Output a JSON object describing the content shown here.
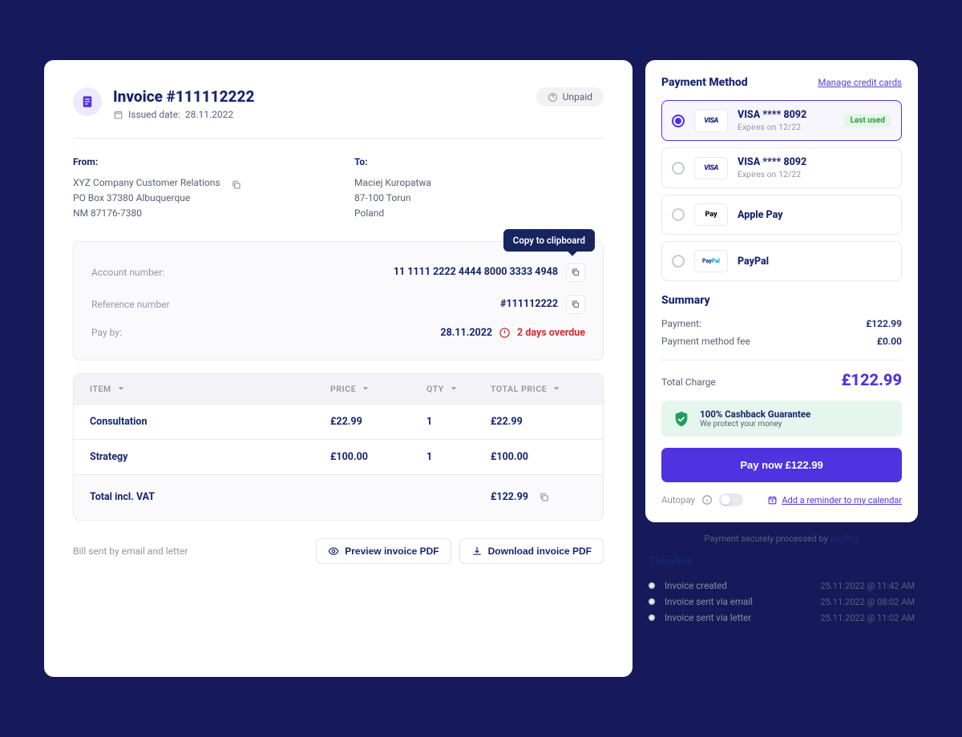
{
  "invoice": {
    "title": "Invoice #111112222",
    "issued_label": "Issued date:",
    "issued_date": "28.11.2022",
    "status": "Unpaid"
  },
  "from": {
    "label": "From:",
    "line1": "XYZ Company Customer Relations",
    "line2": "PO Box 37380 Albuquerque",
    "line3": "NM 87176-7380"
  },
  "to": {
    "label": "To:",
    "line1": "Maciej Kuropatwa",
    "line2": "87-100 Torun",
    "line3": "Poland"
  },
  "payinfo": {
    "account_label": "Account number:",
    "account_value": "11 1111 2222 4444 8000 3333 4948",
    "reference_label": "Reference number",
    "reference_value": "#111112222",
    "payby_label": "Pay by:",
    "payby_date": "28.11.2022",
    "overdue": "2 days overdue",
    "tooltip": "Copy to clipboard"
  },
  "items": {
    "headers": {
      "item": "ITEM",
      "price": "PRICE",
      "qty": "QTY",
      "total": "TOTAL PRICE"
    },
    "rows": [
      {
        "item": "Consultation",
        "price": "£22.99",
        "qty": "1",
        "total": "£22.99"
      },
      {
        "item": "Strategy",
        "price": "£100.00",
        "qty": "1",
        "total": "£100.00"
      }
    ],
    "total_label": "Total incl. VAT",
    "total_value": "£122.99"
  },
  "footer": {
    "note": "Bill sent by email and letter",
    "preview": "Preview invoice PDF",
    "download": "Download invoice PDF"
  },
  "payment": {
    "title": "Payment Method",
    "manage_link": "Manage credit cards",
    "methods": [
      {
        "name": "VISA **** 8092",
        "sub": "Expires on 12/22",
        "badge": "Last used"
      },
      {
        "name": "VISA **** 8092",
        "sub": "Expires on 12/22"
      },
      {
        "name": "Apple Pay"
      },
      {
        "name": "PayPal"
      }
    ]
  },
  "summary": {
    "title": "Summary",
    "payment_label": "Payment:",
    "payment_value": "£122.99",
    "fee_label": "Payment method fee",
    "fee_value": "£0.00",
    "total_label": "Total Charge",
    "total_value": "£122.99"
  },
  "guarantee": {
    "title": "100% Cashback Guarantee",
    "sub": "We protect your money"
  },
  "pay_button": "Pay now £122.99",
  "autopay": {
    "label": "Autopay",
    "reminder": "Add a reminder to my calendar"
  },
  "secure": {
    "prefix": "Payment securely processed by ",
    "brand": "payPay"
  },
  "timeline": {
    "title": "Timeline",
    "events": [
      {
        "text": "Invoice created",
        "time": "25.11.2022 @ 11:42 AM"
      },
      {
        "text": "Invoice sent via email",
        "time": "25.11.2022 @ 08:02 AM"
      },
      {
        "text": "Invoice sent via letter",
        "time": "25.11.2022 @ 11:02 AM"
      }
    ]
  }
}
